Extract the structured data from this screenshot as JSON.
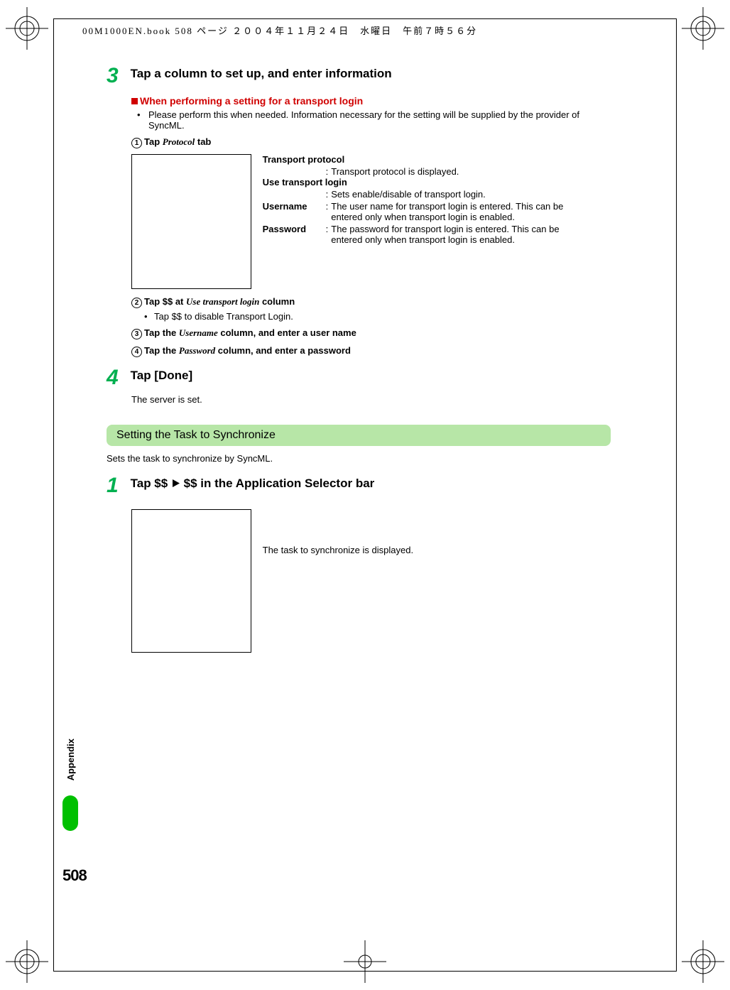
{
  "header": {
    "filepath": "00M1000EN.book  508 ページ  ２００４年１１月２４日　水曜日　午前７時５６分"
  },
  "step3": {
    "num": "3",
    "title": "Tap a column to set up, and enter information",
    "red_heading": "When performing a setting for a transport login",
    "bullet": "Please perform this when needed. Information necessary for the setting will be supplied by the provider of SyncML.",
    "sub1": {
      "num": "1",
      "text_a": "Tap ",
      "italic": "Protocol",
      "text_b": " tab"
    },
    "defs": {
      "tp_label": "Transport protocol",
      "tp_val": "Transport protocol is displayed.",
      "utl_label": "Use transport login",
      "utl_val": "Sets enable/disable of transport login.",
      "un_label": "Username",
      "un_val": "The user name for transport login is entered. This can be entered only when transport login is enabled.",
      "pw_label": "Password",
      "pw_val": "The password for transport login is entered. This can be entered only when transport login is enabled."
    },
    "sub2": {
      "num": "2",
      "text_a": "Tap $$ at ",
      "italic": "Use transport login",
      "text_b": " column"
    },
    "sub2_bullet": "Tap $$ to disable Transport Login.",
    "sub3": {
      "num": "3",
      "text_a": "Tap the ",
      "italic": "Username",
      "text_b": " column, and enter a user name"
    },
    "sub4": {
      "num": "4",
      "text_a": "Tap the ",
      "italic": "Password",
      "text_b": " column, and enter a password"
    }
  },
  "step4": {
    "num": "4",
    "title": "Tap [Done]",
    "body": "The server is set."
  },
  "section2": {
    "heading": "Setting the Task to Synchronize",
    "intro": "Sets the task to synchronize by SyncML."
  },
  "sec2_step1": {
    "num": "1",
    "title_a": "Tap $$ ",
    "title_b": " $$ in the Application Selector bar",
    "caption": "The task to synchronize is displayed."
  },
  "side": {
    "tab": "Appendix",
    "page": "508"
  }
}
